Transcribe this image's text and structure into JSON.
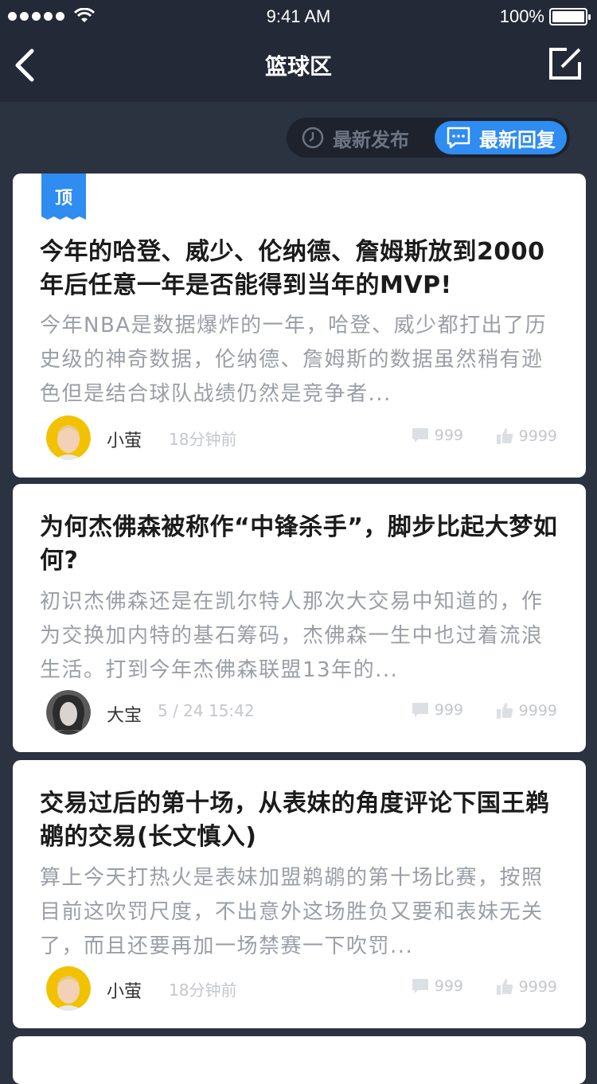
{
  "status": {
    "time": "9:41 AM",
    "battery": "100%",
    "battery_level": 1.0
  },
  "nav": {
    "title": "篮球区",
    "back_icon": "chevron-left-icon",
    "edit_icon": "edit-icon"
  },
  "filter": {
    "latest_post": "最新发布",
    "latest_reply": "最新回复",
    "active": "latest_reply"
  },
  "posts": [
    {
      "pin_label": "顶",
      "title": "今年的哈登、威少、伦纳德、詹姆斯放到2000年后任意一年是否能得到当年的MVP!",
      "excerpt": "今年NBA是数据爆炸的一年，哈登、威少都打出了历史级的神奇数据，伦纳德、詹姆斯的数据虽然稍有逊色但是结合球队战绩仍然是竞争者...",
      "author": "小萤",
      "time": "18分钟前",
      "comments": "999",
      "likes": "9999"
    },
    {
      "title": "为何杰佛森被称作“中锋杀手”，脚步比起大梦如何?",
      "excerpt": "初识杰佛森还是在凯尔特人那次大交易中知道的，作为交换加内特的基石筹码，杰佛森一生中也过着流浪生活。打到今年杰佛森联盟13年的...",
      "author": "大宝",
      "time": "5 / 24 15:42",
      "comments": "999",
      "likes": "9999"
    },
    {
      "title": "交易过后的第十场，从表妹的角度评论下国王鹈鹕的交易(长文慎入)",
      "excerpt": "算上今天打热火是表妹加盟鹈鹕的第十场比赛，按照目前这吹罚尺度，不出意外这场胜负又要和表妹无关了，而且还要再加一场禁赛一下吹罚...",
      "author": "小萤",
      "time": "18分钟前",
      "comments": "999",
      "likes": "9999"
    }
  ],
  "colors": {
    "accent": "#2f8cf0",
    "background": "#2b3240",
    "bar": "#232936"
  }
}
